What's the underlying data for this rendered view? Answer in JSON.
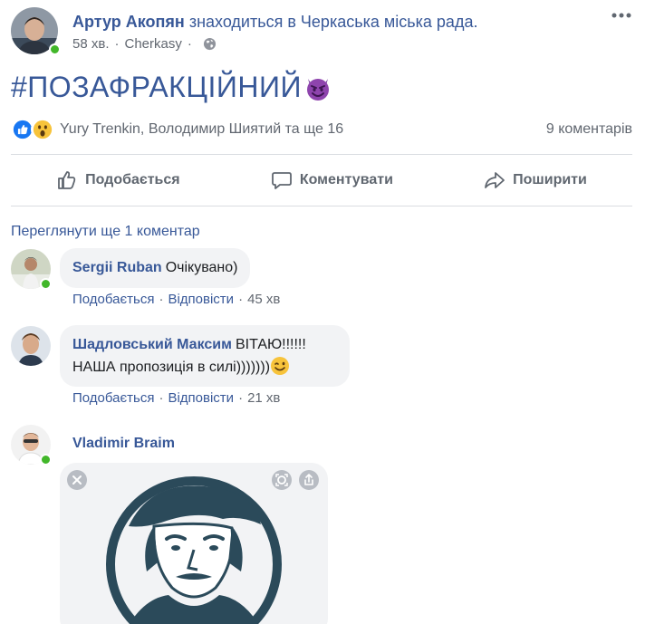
{
  "post": {
    "author_name": "Артур Акопян",
    "author_suffix": " знаходиться в Черкаська міська рада.",
    "time": "58 хв.",
    "location": "Cherkasy",
    "text": "#ПОЗАФРАКЦІЙНИЙ",
    "text_emoji": "smiling-devil-emoji",
    "reactions_text": "Yury Trenkin, Володимир Шиятий та ще 16",
    "comments_count": "9 коментарів",
    "actions": {
      "like": "Подобається",
      "comment": "Коментувати",
      "share": "Поширити"
    }
  },
  "comments_section": {
    "view_more": "Переглянути ще 1 коментар",
    "comments": [
      {
        "author": "Sergii Ruban",
        "text": "Очікувано)",
        "like": "Подобається",
        "reply": "Відповісти",
        "time": "45 хв"
      },
      {
        "author": "Шадловський Максим",
        "text_line1": "ВІТАЮ!!!!!!",
        "text_line2": "НАША пропозиція в силі)))))))",
        "text_emoji": "wink-emoji",
        "like": "Подобається",
        "reply": "Відповісти",
        "time": "21 хв"
      },
      {
        "author": "Vladimir Braim",
        "attachment": "sticker-image"
      }
    ]
  },
  "colors": {
    "link": "#385898",
    "muted": "#616770",
    "bubble": "#f2f3f5",
    "online": "#42b72a",
    "like_blue": "#1877f2",
    "logo_dark": "#2b4a5a"
  }
}
